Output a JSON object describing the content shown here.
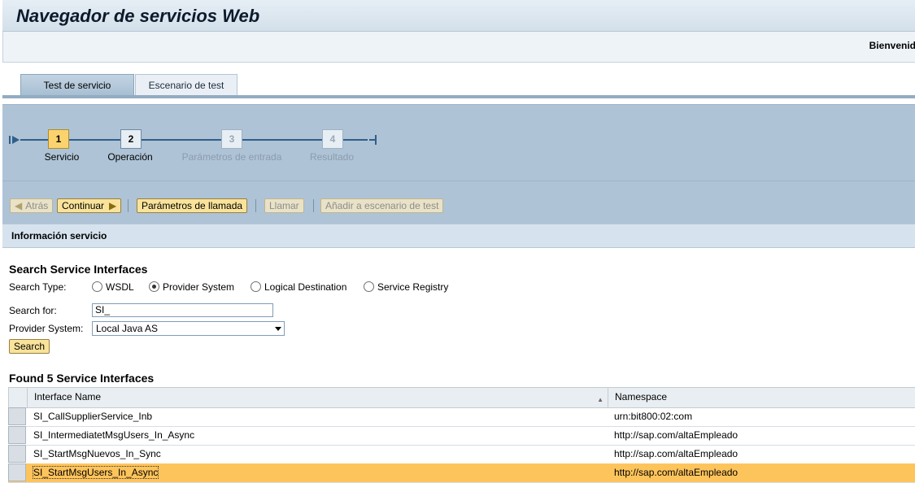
{
  "header": {
    "title": "Navegador de servicios Web",
    "welcome": "Bienvenid"
  },
  "tabs": [
    {
      "label": "Test de servicio"
    },
    {
      "label": "Escenario de test"
    }
  ],
  "roadmap": {
    "steps": [
      {
        "number": "1",
        "label": "Servicio",
        "state": "active"
      },
      {
        "number": "2",
        "label": "Operación",
        "state": "enabled"
      },
      {
        "number": "3",
        "label": "Parámetros de entrada",
        "state": "disabled"
      },
      {
        "number": "4",
        "label": "Resultado",
        "state": "disabled"
      }
    ]
  },
  "toolbar": {
    "back": "Atrás",
    "continue": "Continuar",
    "call_params": "Parámetros de llamada",
    "call": "Llamar",
    "add_scenario": "Añadir a escenario de test"
  },
  "section": {
    "title": "Información servicio"
  },
  "search": {
    "heading": "Search Service Interfaces",
    "type_label": "Search Type:",
    "types": [
      {
        "label": "WSDL",
        "selected": false
      },
      {
        "label": "Provider System",
        "selected": true
      },
      {
        "label": "Logical Destination",
        "selected": false
      },
      {
        "label": "Service Registry",
        "selected": false
      }
    ],
    "for_label": "Search for:",
    "for_value": "SI_",
    "provider_label": "Provider System:",
    "provider_value": "Local Java AS",
    "button": "Search"
  },
  "results": {
    "heading": "Found 5 Service Interfaces",
    "columns": [
      "Interface Name",
      "Namespace"
    ],
    "rows": [
      {
        "name": "SI_CallSupplierService_Inb",
        "ns": "urn:bit800:02:com"
      },
      {
        "name": "SI_IntermediatetMsgUsers_In_Async",
        "ns": "http://sap.com/altaEmpleado"
      },
      {
        "name": "SI_StartMsgNuevos_In_Sync",
        "ns": "http://sap.com/altaEmpleado"
      },
      {
        "name": "SI_StartMsgUsers_In_Async",
        "ns": "http://sap.com/altaEmpleado"
      }
    ],
    "selected_row": 3
  },
  "colors": {
    "accent": "#fbd36e",
    "selected_row": "#fec45c",
    "roadmap_bg": "#aec3d6"
  }
}
